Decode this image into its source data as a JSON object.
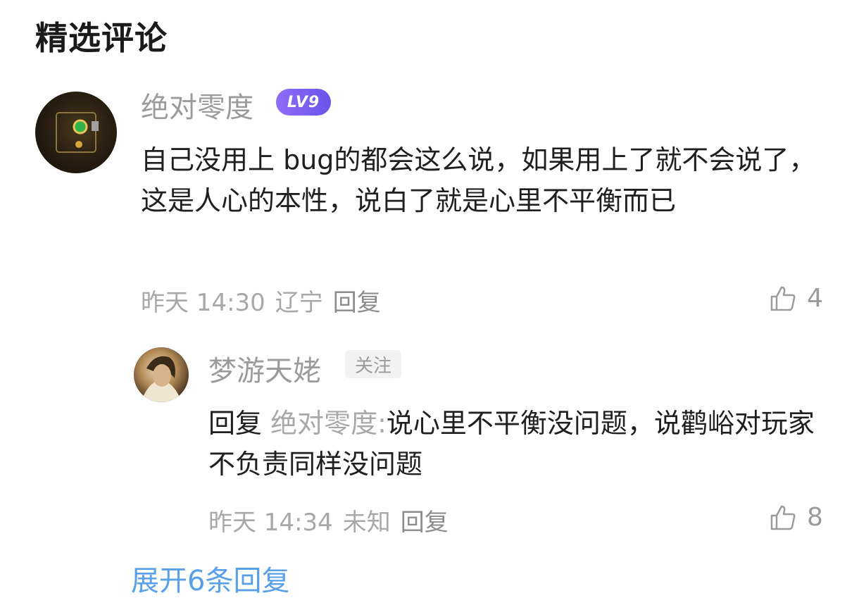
{
  "section_title": "精选评论",
  "comment": {
    "username": "绝对零度",
    "level_badge": "LV9",
    "text": "自己没用上 bug的都会这么说，如果用上了就不会说了，这是人心的本性，说白了就是心里不平衡而已",
    "time": "昨天 14:30",
    "location": "辽宁",
    "reply_label": "回复",
    "like_count": "4",
    "like_icon": "thumbs-up-icon"
  },
  "reply": {
    "username": "梦游天姥",
    "follow_label": "关注",
    "prefix": "回复",
    "target": "绝对零度:",
    "text": "说心里不平衡没问题，说鹳峪对玩家不负责同样没问题",
    "time": "昨天 14:34",
    "location": "未知",
    "reply_label": "回复",
    "like_count": "8",
    "like_icon": "thumbs-up-icon"
  },
  "expand_replies": "展开6条回复",
  "colors": {
    "level_badge": "#7b60f0",
    "link_blue": "#5aa0e8",
    "muted_text": "#a8a8a8"
  }
}
